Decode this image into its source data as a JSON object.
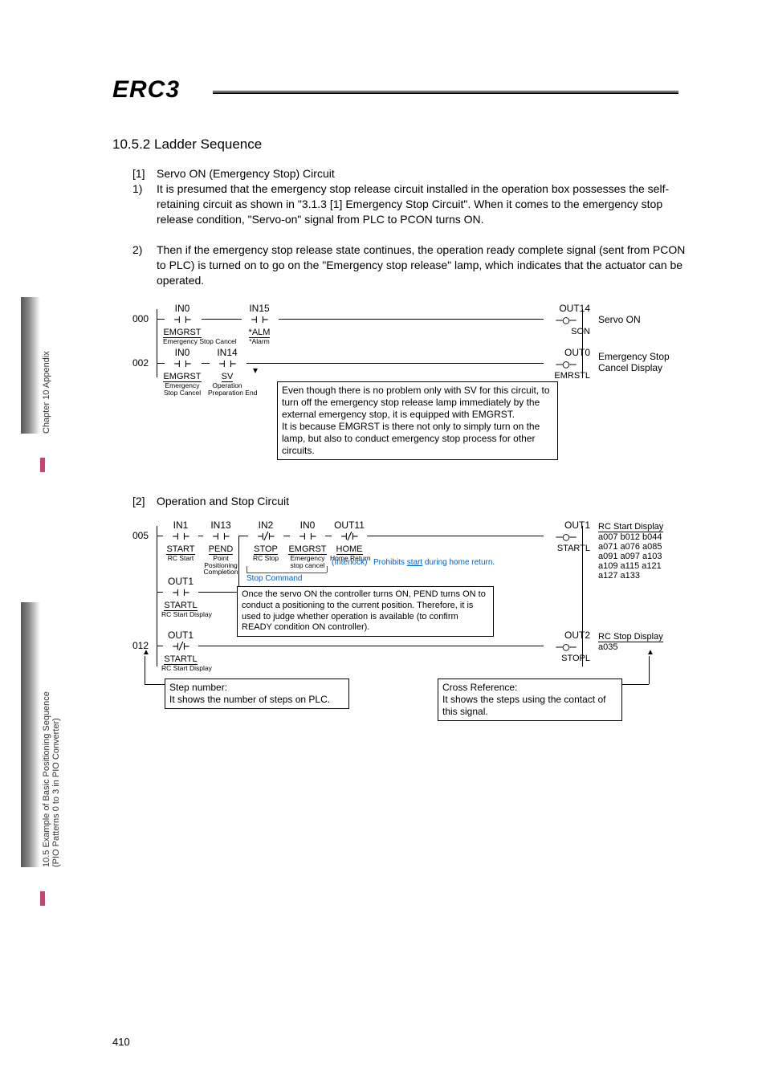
{
  "sidebar": {
    "upper": "Chapter 10 Appendix",
    "lower": "10.5 Example of Basic Positioning Sequence\n(PIO Patterns 0 to 3 in PIO Converter)"
  },
  "logo": "ERC3",
  "section": "10.5.2  Ladder Sequence",
  "item1": {
    "num": "[1]",
    "title": "Servo ON (Emergency Stop) Circuit",
    "p1num": "1)",
    "p1": "It is presumed that the emergency stop release circuit installed in the operation box possesses the self-retaining circuit as shown in \"3.1.3 [1] Emergency Stop Circuit\". When it comes to the emergency stop release condition, \"Servo-on\" signal from PLC to PCON turns ON.",
    "p2num": "2)",
    "p2": "Then if the emergency stop release state continues, the operation ready complete signal (sent from PCON to PLC) is turned on to go on the \"Emergency stop release\" lamp, which indicates that the actuator can be operated."
  },
  "ladder1": {
    "step000": "000",
    "step002": "002",
    "c_in0": "IN0",
    "c_emgrst": "EMGRST",
    "c_emgrst_sub": "Emergency Stop Cancel",
    "c_in15": "IN15",
    "c_alm": "*ALM",
    "c_alm_sub": "*Alarm",
    "c_in14": "IN14",
    "c_sv": "SV",
    "c_sv_sub1": "Emergency",
    "c_sv_sub2": "Stop Cancel",
    "c_op_sub1": "Operation",
    "c_op_sub2": "Preparation End",
    "out14": "OUT14",
    "son": "SON",
    "servo_on": "Servo ON",
    "out0": "OUT0",
    "emrstl": "EMRSTL",
    "es_cancel1": "Emergency Stop",
    "es_cancel2": "Cancel Display",
    "note": "Even though there is no problem only with SV for this circuit, to turn off the emergency stop release lamp immediately by the external emergency stop, it is equipped with EMGRST.\nIt is because EMGRST is there not only to simply turn on the lamp, but also to conduct emergency stop process for other circuits."
  },
  "item2": {
    "num": "[2]",
    "title": "Operation and Stop Circuit"
  },
  "ladder2": {
    "step005": "005",
    "step012": "012",
    "in1": "IN1",
    "start": "START",
    "rcstart": "RC Start",
    "in13": "IN13",
    "pend": "PEND",
    "pend_sub1": "Point",
    "pend_sub2": "Positioning",
    "pend_sub3": "Completion",
    "in2": "IN2",
    "stop": "STOP",
    "rcstop": "RC Stop",
    "in0": "IN0",
    "emgrst": "EMGRST",
    "emg_sub1": "Emergency",
    "emg_sub2": "stop cancel",
    "out11": "OUT11",
    "home": "HOME",
    "home_sub": "Home Return",
    "out1": "OUT1",
    "startl": "STARTL",
    "startl_sub": "RC Start Display",
    "out2": "OUT2",
    "stopl": "STOPL",
    "interlock": "(Interlock)",
    "stopcmd": "Stop Command",
    "prohibit": "Prohibits start during home return.",
    "rc_start_disp": "RC Start Display",
    "rc_stop_disp": "RC Stop Display",
    "xref1": "a007 b012 b044",
    "xref2": "a071 a076 a085",
    "xref3": "a091 a097 a103",
    "xref4": "a109 a115 a121",
    "xref5": "a127 a133",
    "xref_stop": "a035",
    "pend_note": "Once the servo ON the controller turns ON, PEND turns ON to conduct a positioning to the current position. Therefore, it is used to judge whether operation is available (to confirm READY condition ON controller).",
    "stepnum_note": "Step number:\nIt shows the number of steps on PLC.",
    "xref_note": "Cross Reference:\nIt shows the steps using the contact of this signal."
  },
  "pagenum": "410"
}
